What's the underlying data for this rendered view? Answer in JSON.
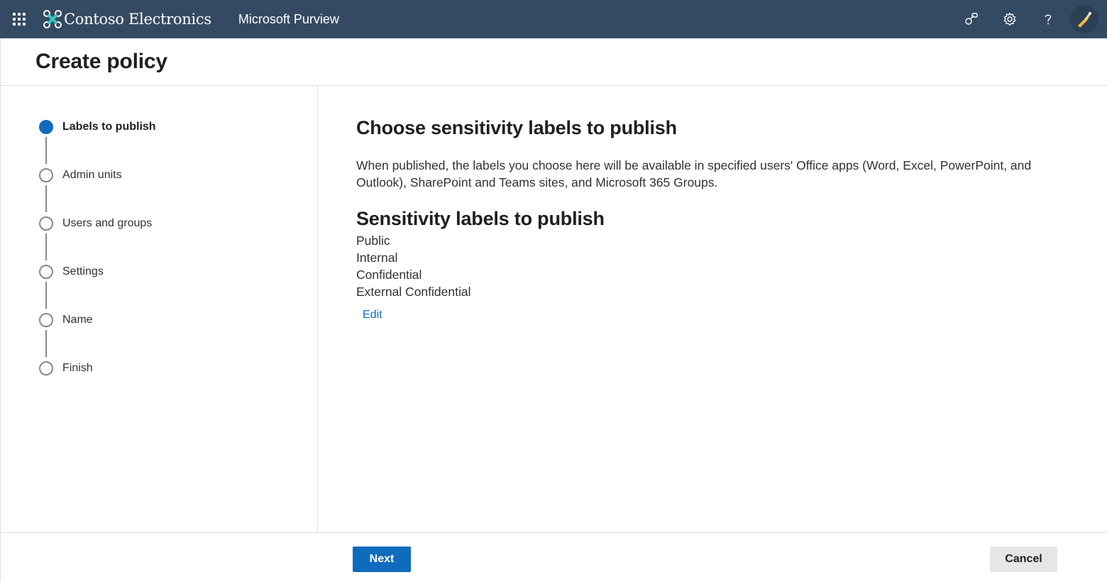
{
  "topbar": {
    "org_name": "Contoso Electronics",
    "app_name": "Microsoft Purview",
    "background": "#344a62",
    "icons": [
      "app-launcher-icon",
      "feedback-icon",
      "gear-icon",
      "help-icon",
      "avatar-icon"
    ]
  },
  "page": {
    "title": "Create policy"
  },
  "stepper": {
    "accent": "#0f6cbd",
    "steps": [
      {
        "label": "Labels to publish",
        "state": "current"
      },
      {
        "label": "Admin units",
        "state": "pending"
      },
      {
        "label": "Users and groups",
        "state": "pending"
      },
      {
        "label": "Settings",
        "state": "pending"
      },
      {
        "label": "Name",
        "state": "pending"
      },
      {
        "label": "Finish",
        "state": "pending"
      }
    ]
  },
  "main": {
    "heading": "Choose sensitivity labels to publish",
    "description": "When published, the labels you choose here will be available in specified users' Office apps (Word, Excel, PowerPoint, and Outlook), SharePoint and Teams sites, and Microsoft 365 Groups.",
    "section_heading": "Sensitivity labels to publish",
    "labels": [
      "Public",
      "Internal",
      "Confidential",
      "External Confidential"
    ],
    "edit_link": "Edit"
  },
  "footer": {
    "next_label": "Next",
    "cancel_label": "Cancel"
  }
}
